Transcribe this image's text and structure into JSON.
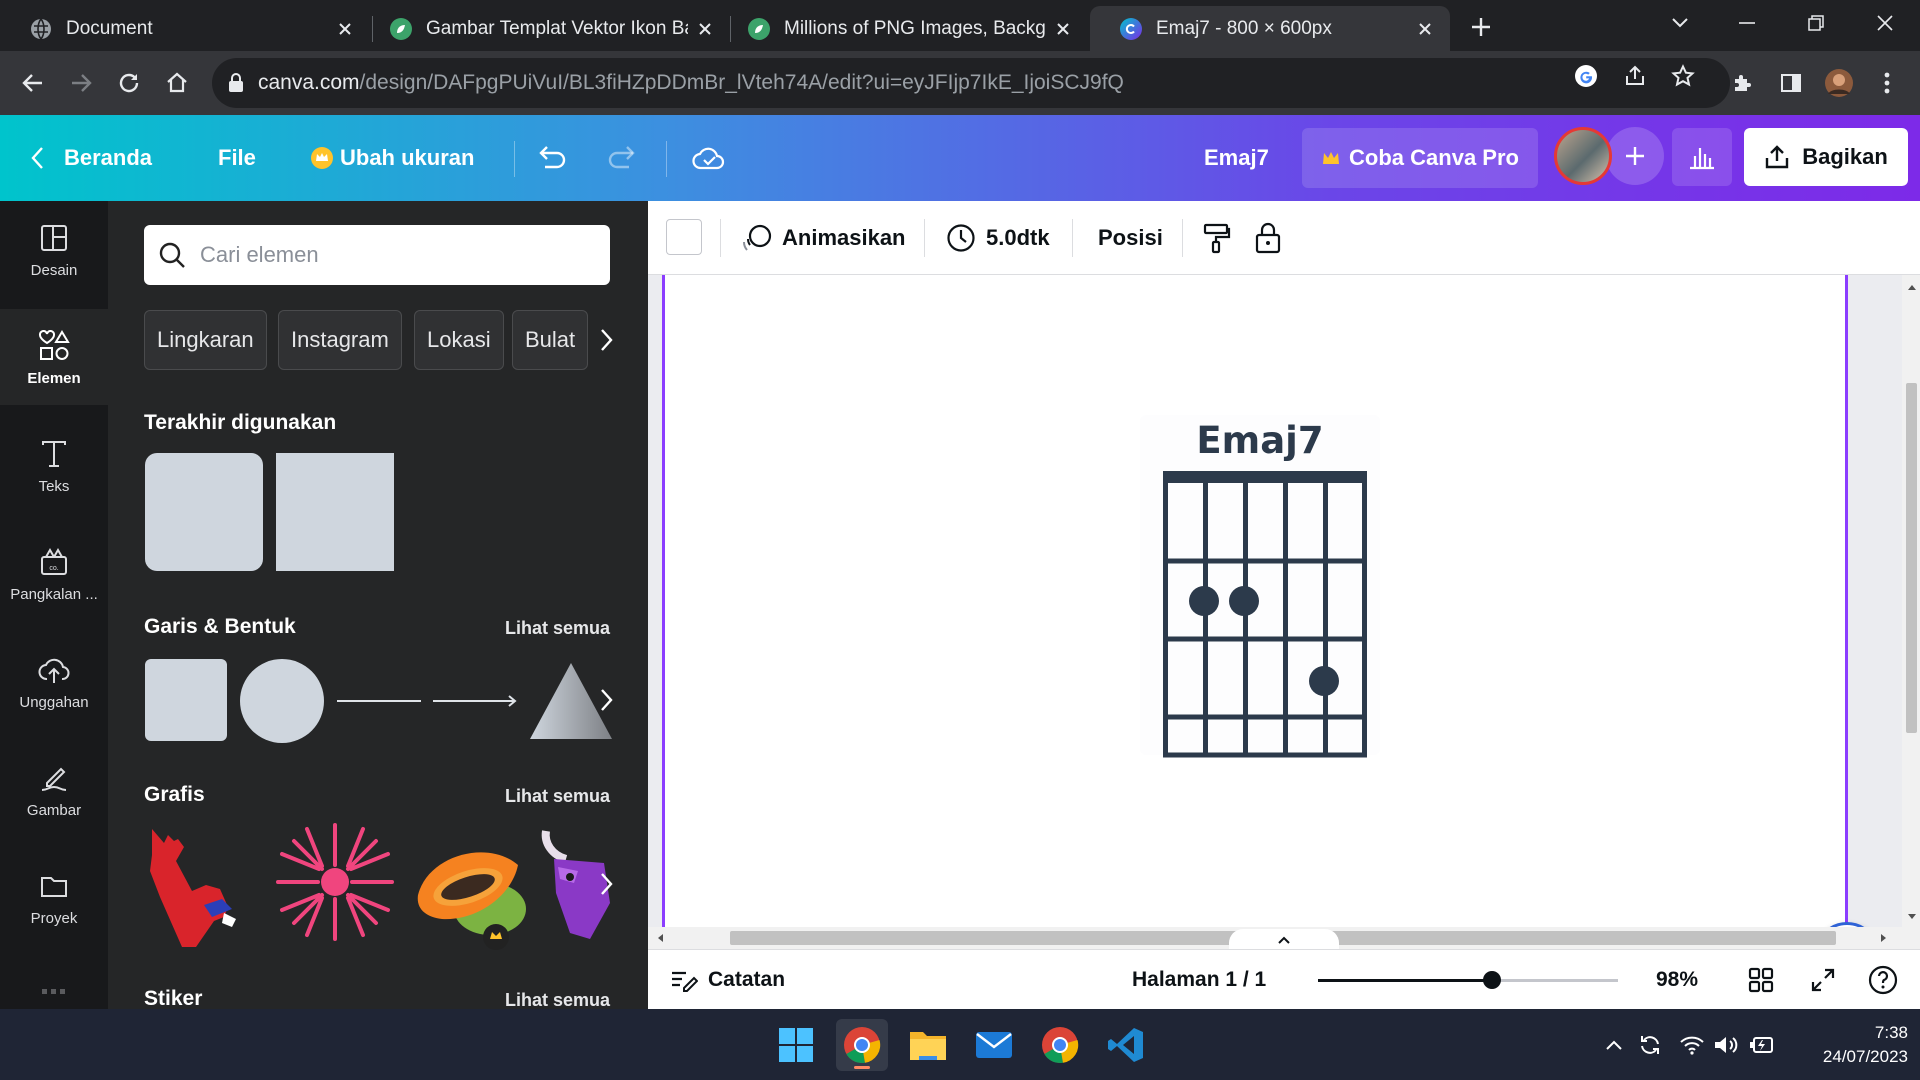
{
  "browser": {
    "tabs": [
      {
        "title": "Document",
        "favicon": "globe-icon"
      },
      {
        "title": "Gambar Templat Vektor Ikon Bag",
        "favicon": "green-leaf-icon"
      },
      {
        "title": "Millions of PNG Images, Backgro",
        "favicon": "green-leaf-icon"
      },
      {
        "title": "Emaj7 - 800 × 600px",
        "favicon": "canva-icon"
      }
    ],
    "url_host": "canva.com",
    "url_path": "/design/DAFpgPUiVuI/BL3fiHZpDDmBr_lVteh74A/edit?ui=eyJFIjp7IkE_IjoiSCJ9fQ"
  },
  "header": {
    "home": "Beranda",
    "file": "File",
    "resize": "Ubah ukuran",
    "doc_title": "Emaj7",
    "pro": "Coba Canva Pro",
    "share": "Bagikan"
  },
  "rail": {
    "items": [
      {
        "label": "Desain",
        "icon": "layout-icon"
      },
      {
        "label": "Elemen",
        "icon": "shapes-icon"
      },
      {
        "label": "Teks",
        "icon": "text-icon"
      },
      {
        "label": "Pangkalan ...",
        "icon": "brand-kit-icon"
      },
      {
        "label": "Unggahan",
        "icon": "cloud-upload-icon"
      },
      {
        "label": "Gambar",
        "icon": "draw-icon"
      },
      {
        "label": "Proyek",
        "icon": "folder-icon"
      }
    ]
  },
  "panel": {
    "search_placeholder": "Cari elemen",
    "chips": [
      "Lingkaran",
      "Instagram",
      "Lokasi",
      "Bulat"
    ],
    "recent_heading": "Terakhir digunakan",
    "shapes_heading": "Garis & Bentuk",
    "graphics_heading": "Grafis",
    "stickers_heading": "Stiker",
    "see_all": "Lihat semua"
  },
  "context_bar": {
    "animate": "Animasikan",
    "duration": "5.0dtk",
    "position": "Posisi"
  },
  "canvas": {
    "chord_name": "Emaj7"
  },
  "footer": {
    "notes": "Catatan",
    "page_indicator": "Halaman 1 / 1",
    "zoom": "98%",
    "zoom_value": 0.58
  },
  "taskbar": {
    "time": "7:38",
    "date": "24/07/2023"
  },
  "colors": {
    "canva_purple": "#8b3dff",
    "canva_teal": "#00c4cc",
    "chord_navy": "#2c3a4b"
  }
}
